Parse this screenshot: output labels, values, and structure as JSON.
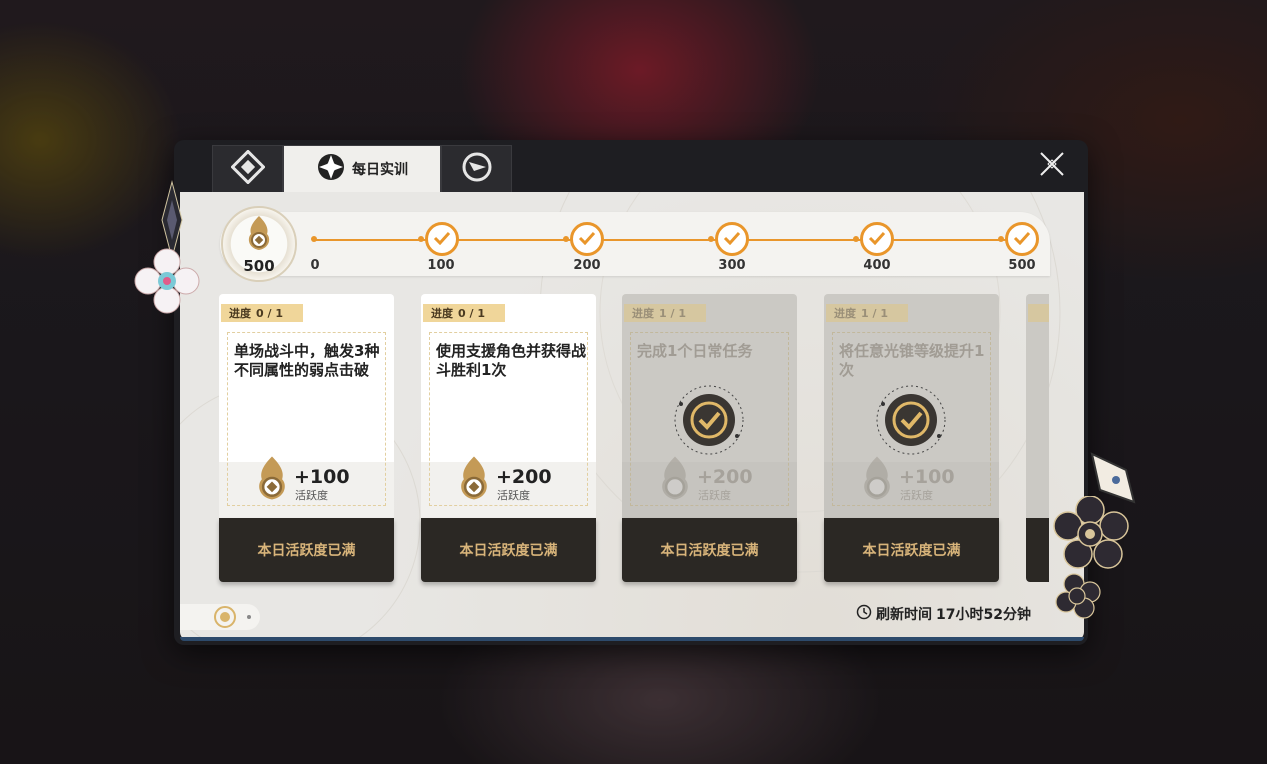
{
  "tabs": [
    {
      "icon": "diamond-emblem-icon",
      "label": ""
    },
    {
      "icon": "daily-training-icon",
      "label": "每日实训"
    },
    {
      "icon": "compass-emblem-icon",
      "label": ""
    }
  ],
  "progress": {
    "total": "500",
    "milestones": [
      {
        "label": "0",
        "checked": false
      },
      {
        "label": "100",
        "checked": true
      },
      {
        "label": "200",
        "checked": true
      },
      {
        "label": "300",
        "checked": true
      },
      {
        "label": "400",
        "checked": true
      },
      {
        "label": "500",
        "checked": true
      }
    ]
  },
  "cards": [
    {
      "progress_label": "进度",
      "progress_value": "0 / 1",
      "desc": "单场战斗中，触发3种不同属性的弱点击破",
      "reward": "+100",
      "reward_label": "活跃度",
      "footer": "本日活跃度已满",
      "done": false
    },
    {
      "progress_label": "进度",
      "progress_value": "0 / 1",
      "desc": "使用支援角色并获得战斗胜利1次",
      "reward": "+200",
      "reward_label": "活跃度",
      "footer": "本日活跃度已满",
      "done": false
    },
    {
      "progress_label": "进度",
      "progress_value": "1 / 1",
      "desc": "完成1个日常任务",
      "reward": "+200",
      "reward_label": "活跃度",
      "footer": "本日活跃度已满",
      "done": true
    },
    {
      "progress_label": "进度",
      "progress_value": "1 / 1",
      "desc": "将任意光锥等级提升1次",
      "reward": "+100",
      "reward_label": "活跃度",
      "footer": "本日活跃度已满",
      "done": true
    }
  ],
  "refresh": {
    "label": "刷新时间",
    "value": "17小时52分钟"
  },
  "colors": {
    "accent": "#e9962b",
    "footer_text": "#d8b47a",
    "footer_bg": "#2b2824"
  }
}
